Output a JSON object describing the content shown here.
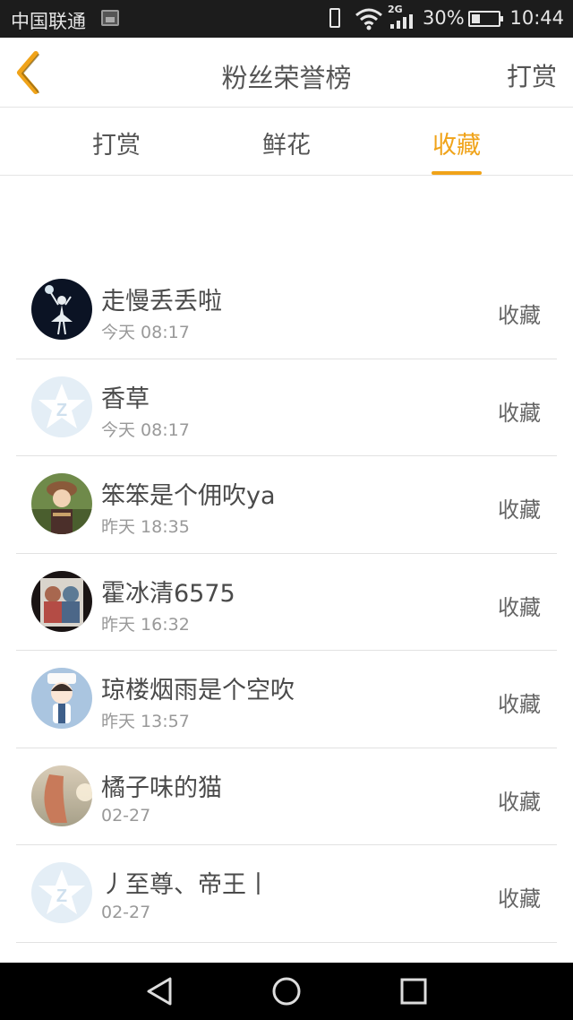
{
  "status_bar": {
    "carrier": "中国联通",
    "network": "2G",
    "battery": "30%",
    "time": "10:44"
  },
  "header": {
    "title": "粉丝荣誉榜",
    "right_action": "打赏",
    "back_icon": "chevron-left-icon",
    "accent_color": "#f0a319"
  },
  "tabs": [
    {
      "label": "打赏",
      "active": false
    },
    {
      "label": "鲜花",
      "active": false
    },
    {
      "label": "收藏",
      "active": true
    }
  ],
  "list": [
    {
      "name": "走慢丢丢啦",
      "time": "今天 08:17",
      "action": "收藏",
      "avatar": "dancer-avatar"
    },
    {
      "name": "香草",
      "time": "今天 08:17",
      "action": "收藏",
      "avatar": "default-star-avatar"
    },
    {
      "name": "笨笨是个佣吹ya",
      "time": "昨天 18:35",
      "action": "收藏",
      "avatar": "character-avatar"
    },
    {
      "name": "霍冰清6575",
      "time": "昨天 16:32",
      "action": "收藏",
      "avatar": "two-characters-avatar"
    },
    {
      "name": "琼楼烟雨是个空吹",
      "time": "昨天 13:57",
      "action": "收藏",
      "avatar": "chibi-avatar"
    },
    {
      "name": "橘子味的猫",
      "time": "02-27",
      "action": "收藏",
      "avatar": "sunset-avatar"
    },
    {
      "name": "丿至尊、帝王丨",
      "time": "02-27",
      "action": "收藏",
      "avatar": "default-star-avatar"
    }
  ]
}
